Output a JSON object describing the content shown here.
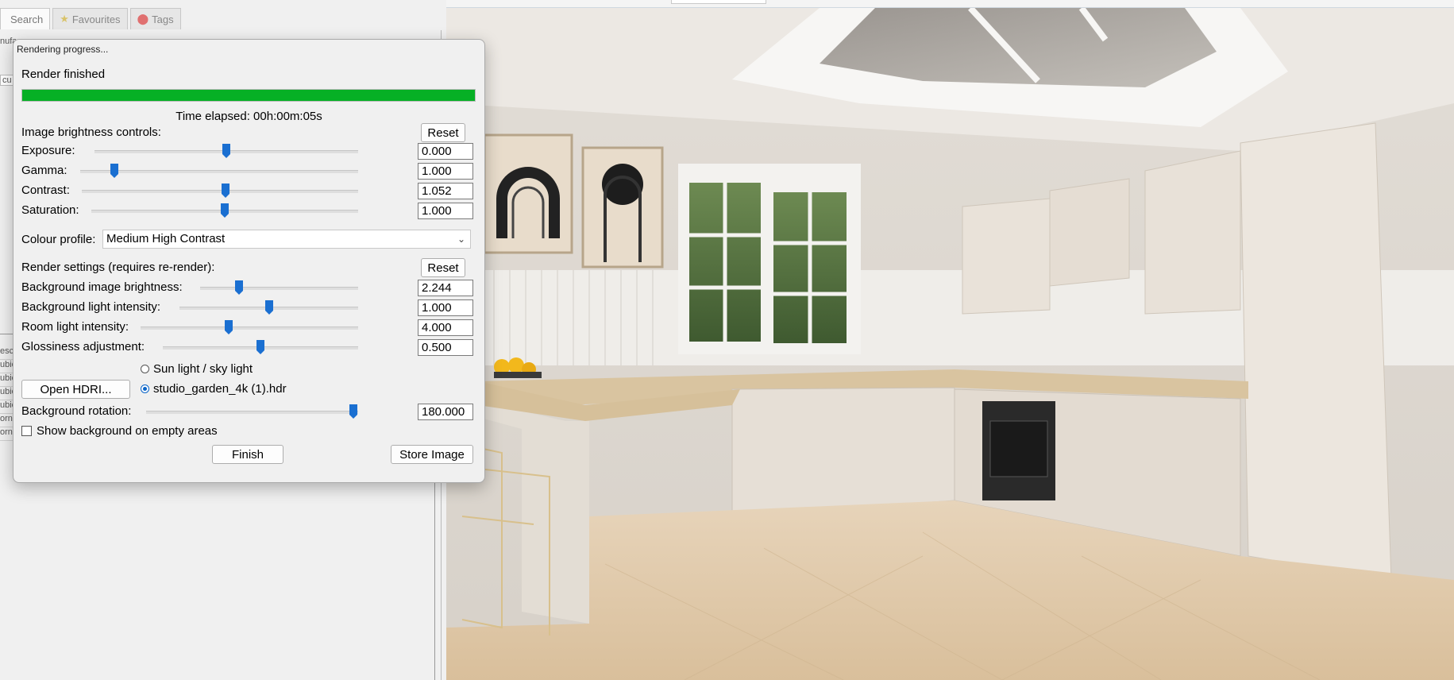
{
  "tabs": [
    {
      "label": "Search",
      "icon": "search-icon",
      "active": true
    },
    {
      "label": "Favourites",
      "icon": "star-icon",
      "active": false
    },
    {
      "label": "Tags",
      "icon": "tag-icon",
      "active": false
    }
  ],
  "left_panel": {
    "fragment_manufacturer": "nufa",
    "fragment_input": "cu",
    "list_fragments": [
      "esc",
      "ubic",
      "ubic",
      "ubic",
      "ubic",
      "orne",
      "orne"
    ]
  },
  "dialog": {
    "title": "Rendering progress...",
    "status": "Render finished",
    "progress": 1.0,
    "progress_color": "#06b025",
    "elapsed": "Time elapsed: 00h:00m:05s",
    "brightness_heading": "Image brightness controls:",
    "reset_label": "Reset",
    "brightness": [
      {
        "label": "Exposure:",
        "value": "0.000",
        "level": 0.5
      },
      {
        "label": "Gamma:",
        "value": "1.000",
        "level": 0.11
      },
      {
        "label": "Contrast:",
        "value": "1.052",
        "level": 0.52
      },
      {
        "label": "Saturation:",
        "value": "1.000",
        "level": 0.5
      }
    ],
    "colour_profile": {
      "label": "Colour profile:",
      "selected": "Medium High Contrast"
    },
    "render_heading": "Render settings (requires re-render):",
    "render_settings": [
      {
        "label": "Background image brightness:",
        "value": "2.244",
        "level": 0.23
      },
      {
        "label": "Background light intensity:",
        "value": "1.000",
        "level": 0.5
      },
      {
        "label": "Room light intensity:",
        "value": "4.000",
        "level": 0.4
      },
      {
        "label": "Glossiness adjustment:",
        "value": "0.500",
        "level": 0.5
      }
    ],
    "sun_option": "Sun light / sky light",
    "hdri_option": "studio_garden_4k (1).hdr",
    "open_hdri_label": "Open HDRI...",
    "rotation": {
      "label": "Background rotation:",
      "value": "180.000",
      "level": 1.0
    },
    "show_background_label": "Show background on empty areas",
    "finish_label": "Finish",
    "store_label": "Store Image",
    "accent": "#1a6fd1"
  }
}
